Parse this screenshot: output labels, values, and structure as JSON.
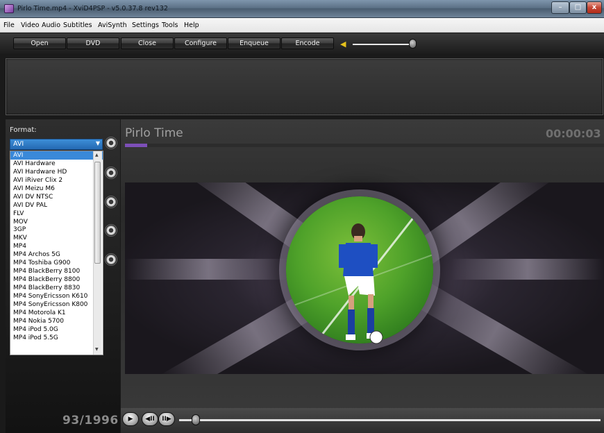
{
  "window": {
    "title": "Pirlo Time.mp4  - XviD4PSP - v5.0.37.8  rev132",
    "minimize": "–",
    "maximize": "□",
    "close": "x"
  },
  "menu": [
    "File",
    "Video",
    "Audio",
    "Subtitles",
    "AviSynth",
    "Settings",
    "Tools",
    "Help"
  ],
  "toolbar": {
    "buttons": [
      "Open",
      "DVD",
      "Close",
      "Configure",
      "Enqueue",
      "Encode"
    ],
    "volume_icon": "speaker-icon",
    "volume_level": 0.95
  },
  "format": {
    "label": "Format:",
    "selected": "AVI",
    "options": [
      "AVI",
      "AVI Hardware",
      "AVI Hardware HD",
      "AVI iRiver Clix 2",
      "AVI Meizu M6",
      "AVI DV NTSC",
      "AVI DV PAL",
      "FLV",
      "MOV",
      "3GP",
      "MKV",
      "MP4",
      "MP4 Archos 5G",
      "MP4 Toshiba G900",
      "MP4 BlackBerry 8100",
      "MP4 BlackBerry 8800",
      "MP4 BlackBerry 8830",
      "MP4 SonyEricsson K610",
      "MP4 SonyEricsson K800",
      "MP4 Motorola K1",
      "MP4 Nokia 5700",
      "MP4 iPod 5.0G",
      "MP4 iPod 5.5G"
    ]
  },
  "preview": {
    "title": "Pirlo Time",
    "timecode": "00:00:03",
    "frame_counter": "93/1996",
    "seek_position": 0.03
  },
  "player_controls": {
    "play": "▶",
    "frame_back": "◀II",
    "frame_forward": "II▶"
  }
}
